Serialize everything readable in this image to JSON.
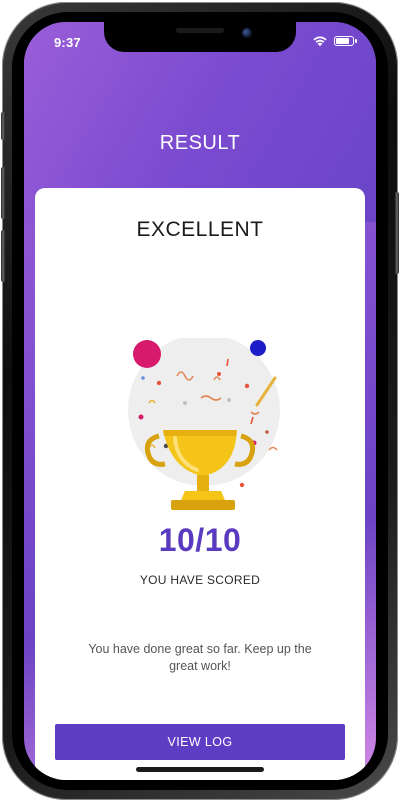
{
  "status_bar": {
    "time": "9:37",
    "icons": [
      "wifi-icon",
      "battery-icon"
    ]
  },
  "header": {
    "title": "RESULT"
  },
  "card": {
    "heading": "EXCELLENT",
    "score": "10/10",
    "score_caption": "YOU HAVE SCORED",
    "message": "You have done great so far. Keep up the great work!",
    "button_label": "VIEW LOG"
  },
  "illustration": {
    "icon": "trophy-icon"
  },
  "colors": {
    "accent": "#5e3cc3",
    "gradient_start": "#9a5ed8",
    "gradient_end": "#6a45c8",
    "trophy": "#f5c418"
  }
}
